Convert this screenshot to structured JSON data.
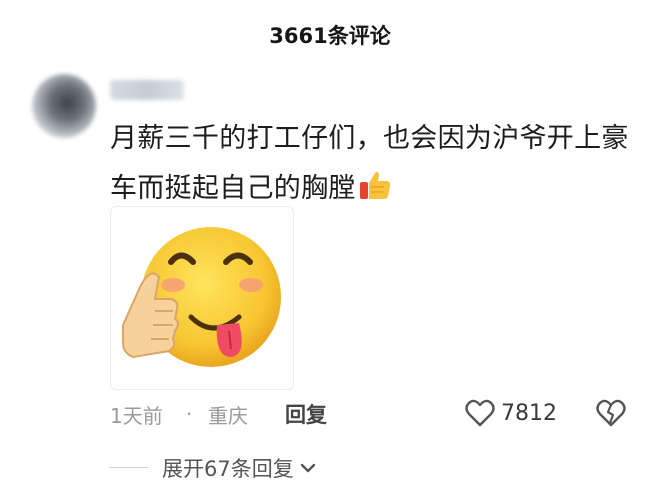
{
  "header": {
    "title": "3661条评论"
  },
  "comment": {
    "text": "月薪三千的打工仔们，也会因为沪爷开上豪车而挺起自己的胸膛",
    "inline_emoji": "thumbs-up-emoji",
    "sticker": "smiley-thumbs-up-tongue-sticker",
    "time": "1天前",
    "separator": "·",
    "location": "重庆",
    "reply_label": "回复",
    "like_count": "7812"
  },
  "replies": {
    "expand_label": "展开67条回复"
  },
  "colors": {
    "meta_gray": "#9a9a9a",
    "text": "#1d1d1d",
    "emoji_yellow": "#f7c531"
  }
}
